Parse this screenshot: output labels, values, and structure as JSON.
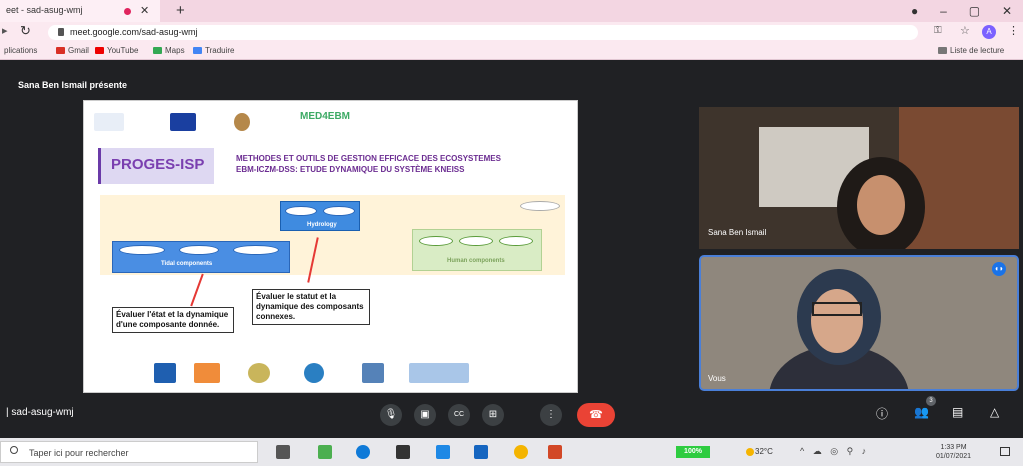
{
  "browser": {
    "tab_title": "eet - sad-asug-wmj",
    "tab_close": "✕",
    "new_tab": "+",
    "window_controls": [
      "●",
      "–",
      "▢",
      "✕"
    ],
    "url": "meet.google.com/sad-asug-wmj",
    "avatar_letter": "A",
    "bookmarks": [
      "plications",
      "Gmail",
      "YouTube",
      "Maps",
      "Traduire"
    ],
    "reading_list": "Liste de lecture"
  },
  "meet": {
    "presenter_label": "Sana Ben Ismail présente",
    "meeting_code": "sad-asug-wmj",
    "participants": [
      {
        "name": "Sana Ben Ismail"
      },
      {
        "name": "Vous"
      }
    ],
    "people_count": "3",
    "controls": [
      "mic",
      "camera",
      "captions",
      "present",
      "more",
      "hangup"
    ],
    "right_controls": [
      "info",
      "people",
      "chat",
      "activities"
    ]
  },
  "slide": {
    "med_logo": "MED4EBM",
    "proges": "PROGES-ISP",
    "title_line1": "METHODES ET OUTILS DE GESTION EFFICACE DES ECOSYSTEMES",
    "title_line2": "EBM-ICZM-DSS: ETUDE DYNAMIQUE DU SYSTÈME KNEISS",
    "hydro_label": "Hydrology",
    "tidal_label": "Tidal components",
    "human_label": "Human components",
    "note1": "Évaluer l'état et la dynamique d'une composante donnée.",
    "note2": "Évaluer le statut et la dynamique des composants connexes."
  },
  "taskbar": {
    "search_placeholder": "Taper ici pour rechercher",
    "battery": "100%",
    "weather": "32°C",
    "time": "1:33 PM",
    "date": "01/07/2021"
  },
  "colors": {
    "accent_blue": "#1a73e8",
    "hangup_red": "#ea4335",
    "slide_purple": "#6b2c91"
  }
}
